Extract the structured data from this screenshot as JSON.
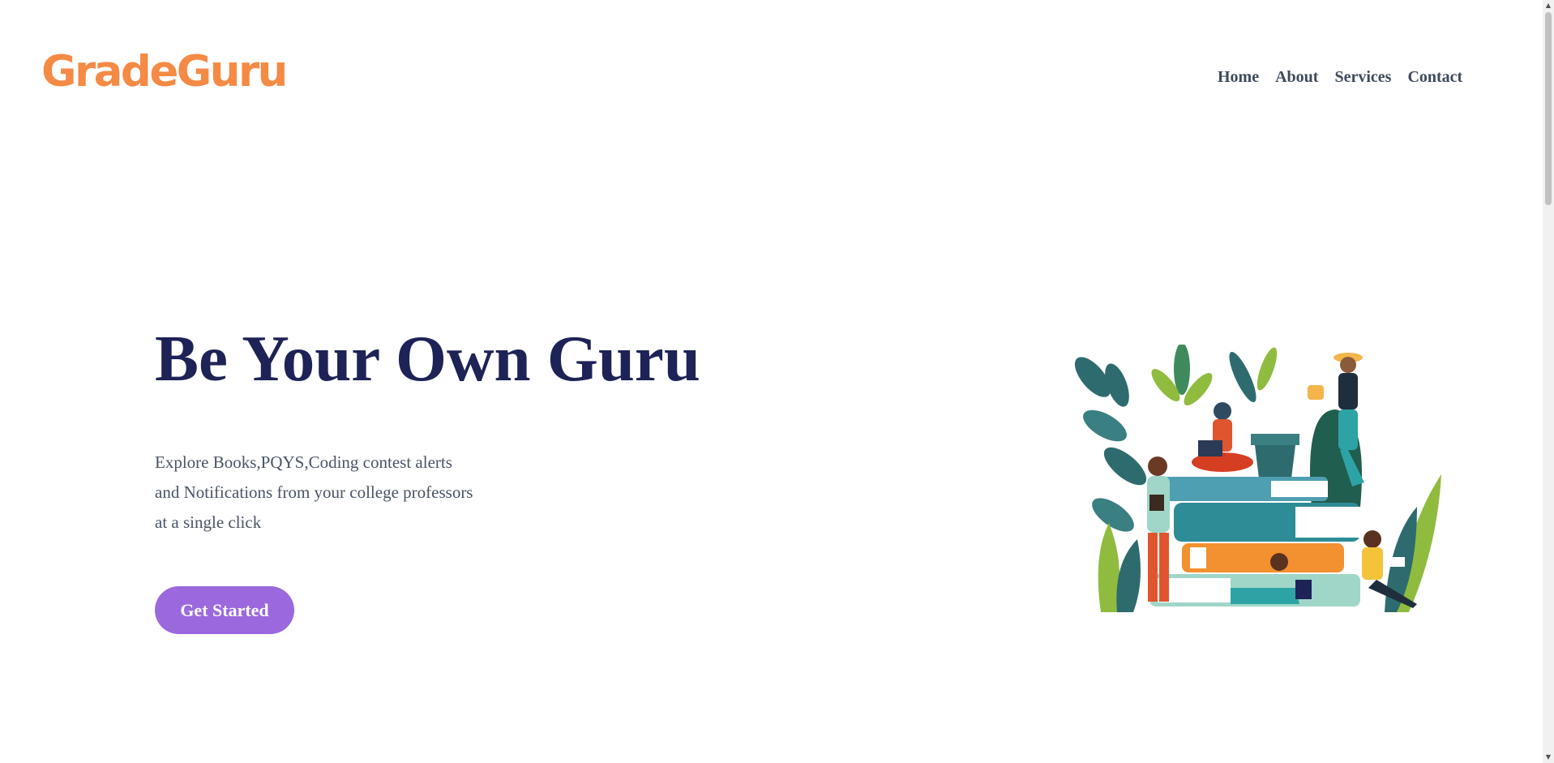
{
  "header": {
    "logo_text": "GradeGuru",
    "nav": [
      {
        "label": "Home"
      },
      {
        "label": "About"
      },
      {
        "label": "Services"
      },
      {
        "label": "Contact"
      }
    ]
  },
  "hero": {
    "title": "Be Your Own Guru",
    "description": "Explore Books,PQYS,Coding contest alerts and Notifications from your college professors at a single click",
    "cta_label": "Get Started"
  },
  "colors": {
    "brand": "#f58a45",
    "title": "#1d2356",
    "text": "#4a5466",
    "nav": "#3e4a5c",
    "button": "#9b68de"
  },
  "icons": {
    "scroll_up": "triangle-up",
    "scroll_down": "triangle-down"
  }
}
